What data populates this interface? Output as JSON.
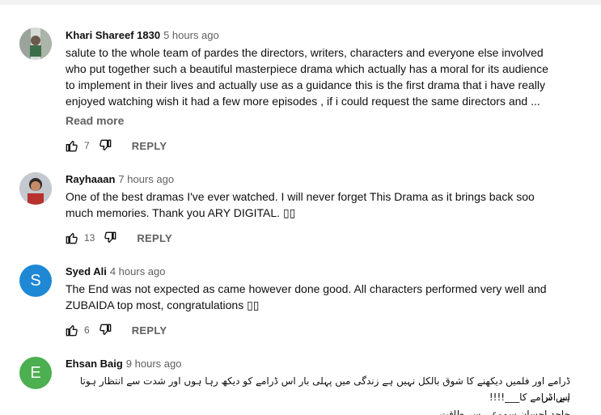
{
  "comments": [
    {
      "author": "Khari Shareef 1830",
      "time": "5 hours ago",
      "text": "salute to the whole team of pardes the directors, writers,  characters and everyone else involved\nwho put together such a beautiful masterpiece drama which actually has a moral for its audience\nto  implement in their lives and actually  use as a guidance this is the first drama that i have really\nenjoyed watching wish it had a few more episodes , if i could request the same directors and ...",
      "read_more": "Read more",
      "likes": "7",
      "reply": "REPLY",
      "avatar_color": "#7a8a7a"
    },
    {
      "author": "Rayhaaan",
      "time": "7 hours ago",
      "text": "One of the best dramas I've ever watched. I will never forget This Drama as it brings back soo\nmuch memories. Thank you ARY DIGITAL. ▯▯",
      "likes": "13",
      "reply": "REPLY",
      "avatar_color": "#5a6470"
    },
    {
      "author": "Syed Ali",
      "time": "4 hours ago",
      "text": "The End was not expected as came however done good. All characters performed very well and\nZUBAIDA top most, congratulations ▯▯",
      "likes": "6",
      "reply": "REPLY",
      "avatar_letter": "S",
      "avatar_color": "#1e88d4"
    },
    {
      "author": "Ehsan Baig",
      "time": "9 hours ago",
      "text_line1": "ڈرامے اور فلمیں دیکھنے کا شوق بالکل نہیں ہے زندگی میں پہلی بار  اس ڈرامے کو دیکھ رہا ہوں اور شدت سے انتظار ہوتا ہے اس",
      "text_line2": "اس ڈرامے کا___!!!!",
      "text_line3": "جاحد احسان سموعی سر طاقت",
      "avatar_letter": "E",
      "avatar_color": "#4caf50"
    }
  ],
  "icons": {
    "like": "thumb-up-icon",
    "dislike": "thumb-down-icon"
  }
}
